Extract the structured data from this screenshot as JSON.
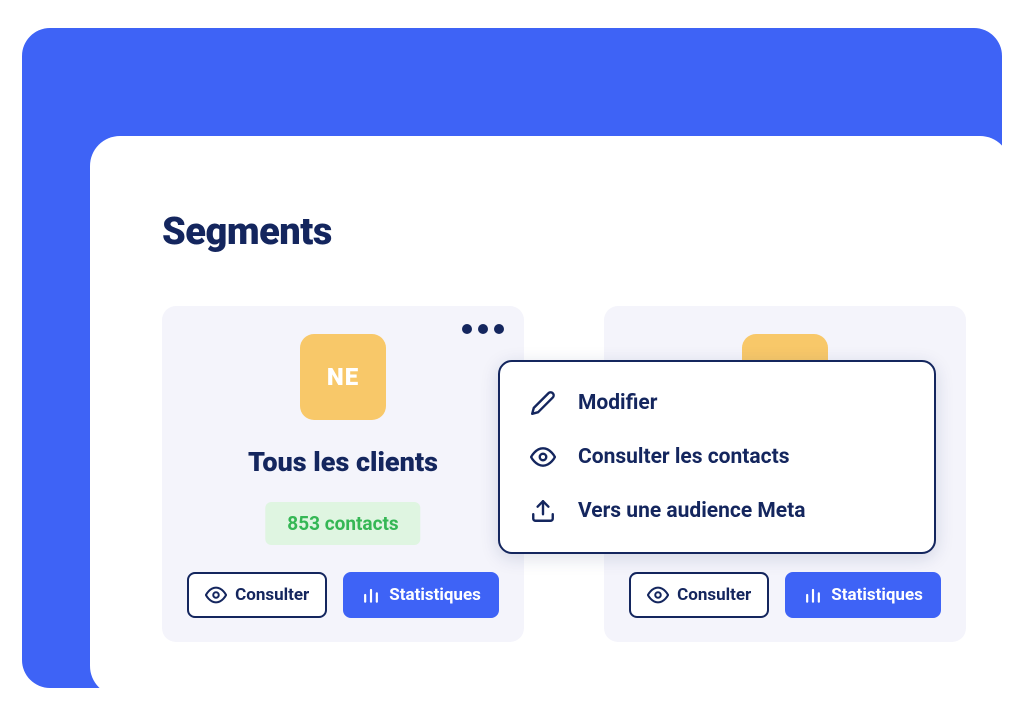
{
  "page": {
    "title": "Segments"
  },
  "cards": [
    {
      "initials": "NE",
      "title": "Tous les clients",
      "contacts": "853 contacts",
      "consult_label": "Consulter",
      "stats_label": "Statistiques"
    },
    {
      "consult_label": "Consulter",
      "stats_label": "Statistiques"
    }
  ],
  "menu": {
    "edit": "Modifier",
    "view_contacts": "Consulter les contacts",
    "export_meta": "Vers une audience Meta"
  }
}
